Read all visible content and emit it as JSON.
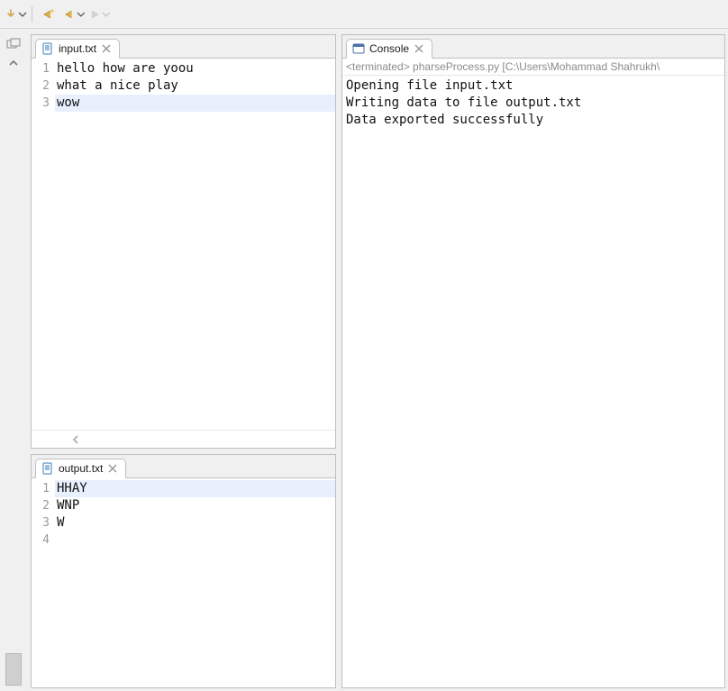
{
  "toolbar": {
    "nav_up": "↥",
    "nav_back": "⬅",
    "nav_back_yellow": "⟸",
    "nav_fwd": "⟹"
  },
  "editors": {
    "input_tab": {
      "label": "input.txt"
    },
    "output_tab": {
      "label": "output.txt"
    },
    "input_lines": [
      {
        "n": "1",
        "text": "hello how are yoou"
      },
      {
        "n": "2",
        "text": "what a nice play"
      },
      {
        "n": "3",
        "text": "wow",
        "highlight": true
      }
    ],
    "output_lines": [
      {
        "n": "1",
        "text": "HHAY",
        "highlight": true
      },
      {
        "n": "2",
        "text": "WNP"
      },
      {
        "n": "3",
        "text": "W"
      },
      {
        "n": "4",
        "text": ""
      }
    ]
  },
  "console": {
    "tab_label": "Console",
    "status_line": "<terminated> pharseProcess.py [C:\\Users\\Mohammad Shahrukh\\",
    "lines": [
      "Opening file input.txt",
      "Writing data to file output.txt",
      "Data exported successfully"
    ]
  }
}
